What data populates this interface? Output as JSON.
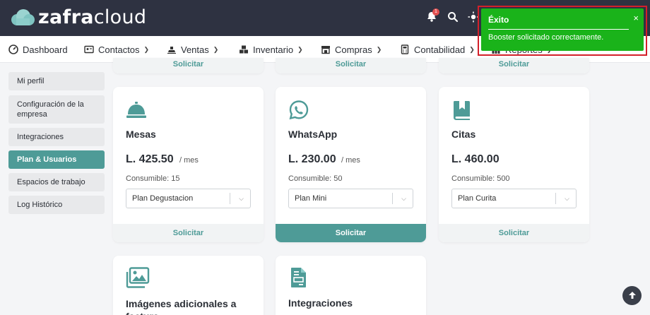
{
  "brand": {
    "name_bold": "zafra",
    "name_light": "cloud"
  },
  "header": {
    "notification_count": "1"
  },
  "nav": {
    "items": [
      {
        "label": "Dashboard",
        "icon": "dashboard-icon"
      },
      {
        "label": "Contactos",
        "icon": "contacts-icon"
      },
      {
        "label": "Ventas",
        "icon": "sales-icon"
      },
      {
        "label": "Inventario",
        "icon": "inventory-icon"
      },
      {
        "label": "Compras",
        "icon": "store-icon"
      },
      {
        "label": "Contabilidad",
        "icon": "calculator-icon"
      },
      {
        "label": "Reportes",
        "icon": "reports-icon"
      }
    ]
  },
  "sidebar": {
    "items": [
      {
        "label": "Mi perfil"
      },
      {
        "label": "Configuración de la empresa"
      },
      {
        "label": "Integraciones"
      },
      {
        "label": "Plan & Usuarios",
        "active": true
      },
      {
        "label": "Espacios de trabajo"
      },
      {
        "label": "Log Histórico"
      }
    ]
  },
  "top_cards": {
    "action_label": "Solicitar"
  },
  "cards": [
    {
      "title": "Mesas",
      "icon": "bell-service-icon",
      "price": "L. 425.50",
      "period": "/ mes",
      "consumable": "Consumible: 15",
      "plan": "Plan Degustacion",
      "action": "Solicitar"
    },
    {
      "title": "WhatsApp",
      "icon": "whatsapp-icon",
      "price": "L. 230.00",
      "period": "/ mes",
      "consumable": "Consumible: 50",
      "plan": "Plan Mini",
      "action": "Solicitar"
    },
    {
      "title": "Citas",
      "icon": "book-bookmark-icon",
      "price": "L. 460.00",
      "period": "",
      "consumable": "Consumible: 500",
      "plan": "Plan Curita",
      "action": "Solicitar"
    },
    {
      "title": "Imágenes adicionales a factura",
      "icon": "images-icon"
    },
    {
      "title": "Integraciones",
      "icon": "file-invoice-icon"
    }
  ],
  "toast": {
    "title": "Éxito",
    "message": "Booster solicitado correctamente.",
    "close": "×"
  },
  "colors": {
    "accent": "#4e9b97",
    "header": "#2e3241",
    "toast": "#1ab31a"
  }
}
